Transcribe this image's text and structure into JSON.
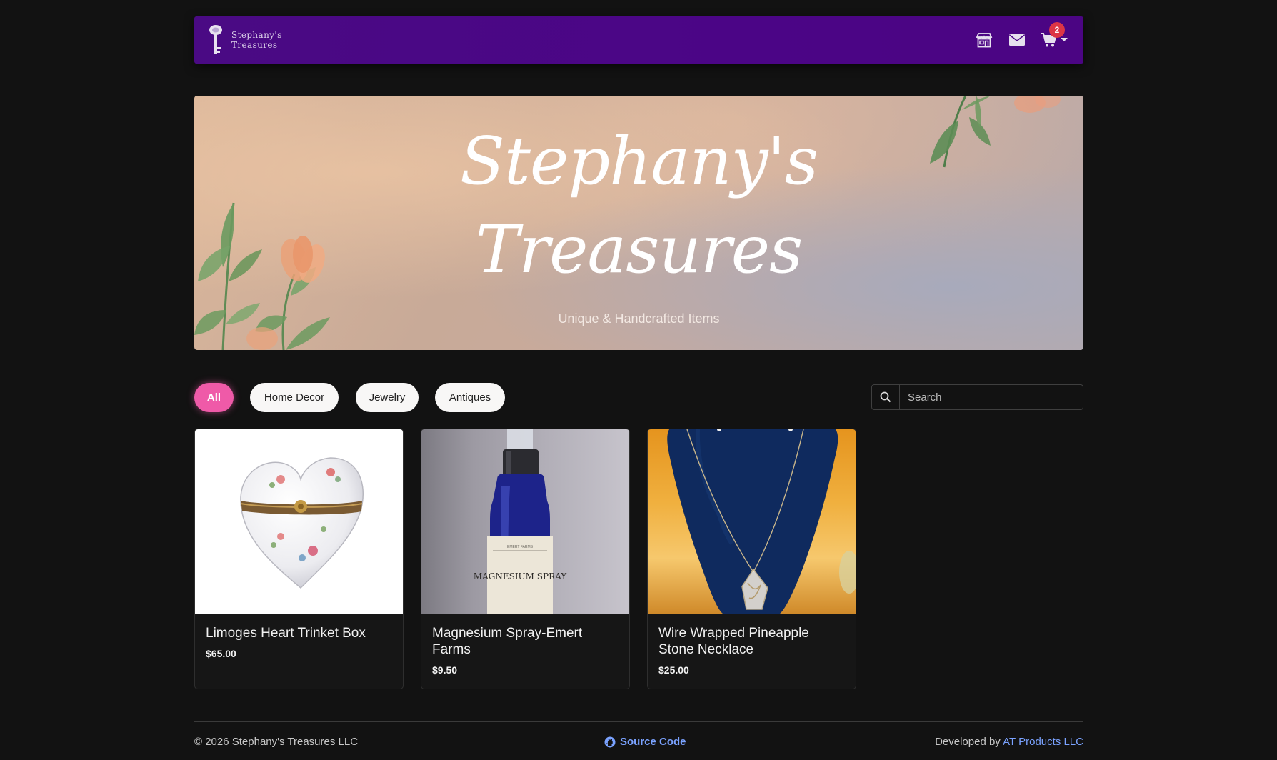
{
  "navbar": {
    "brand_line1": "Stephany's",
    "brand_line2": "Treasures",
    "icons": [
      "shop-icon",
      "envelope-icon",
      "cart-icon"
    ],
    "cart_count": "2",
    "color": "#4b0586"
  },
  "hero": {
    "title_line1": "Stephany's",
    "title_line2": "Treasures",
    "subtitle": "Unique & Handcrafted Items"
  },
  "filters": {
    "chips": [
      {
        "label": "All",
        "active": true
      },
      {
        "label": "Home Decor",
        "active": false
      },
      {
        "label": "Jewelry",
        "active": false
      },
      {
        "label": "Antiques",
        "active": false
      }
    ],
    "active_color": "#ef5aa8",
    "search_placeholder": "Search"
  },
  "products": [
    {
      "title": "Limoges Heart Trinket Box",
      "price": "$65.00"
    },
    {
      "title": "Magnesium Spray-Emert Farms",
      "price": "$9.50",
      "label_text": "MAGNESIUM SPRAY"
    },
    {
      "title": "Wire Wrapped Pineapple Stone Necklace",
      "price": "$25.00"
    }
  ],
  "footer": {
    "copyright": "© 2026 Stephany's Treasures LLC",
    "source_link": "Source Code",
    "developed_by": "Developed by ",
    "developer_link": "AT Products LLC"
  }
}
